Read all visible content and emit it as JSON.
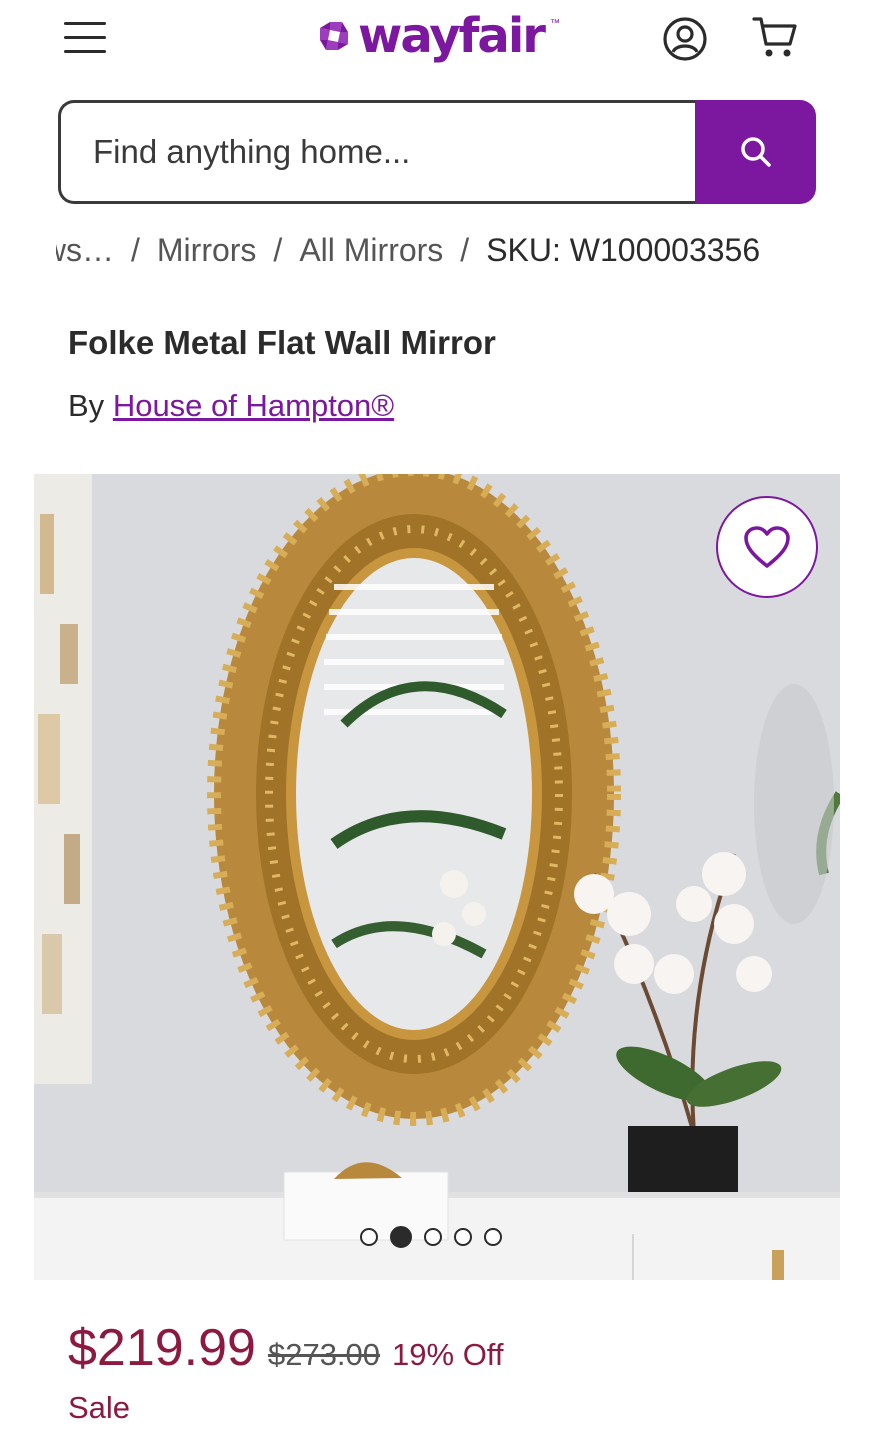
{
  "header": {
    "logo_text": "wayfair",
    "logo_tm": "™",
    "brand_color": "#7b189f",
    "icons": [
      "menu-icon",
      "account-icon",
      "cart-icon"
    ]
  },
  "search": {
    "placeholder": "Find anything home...",
    "icon": "search-icon"
  },
  "breadcrumb": {
    "items": [
      "Mirrors",
      "All Mirrors"
    ],
    "clipped_start": "…ows",
    "separator": "/",
    "current": "SKU: W100003356"
  },
  "product": {
    "title": "Folke Metal Flat Wall Mirror",
    "by_label": "By",
    "brand": "House of Hampton®"
  },
  "gallery": {
    "favorite_icon": "heart-icon",
    "image_count": 5,
    "active_index": 2
  },
  "pricing": {
    "price": "$219.99",
    "original_price": "$273.00",
    "discount": "19% Off",
    "sale_label": "Sale",
    "sale_color": "#8b1a3e"
  }
}
